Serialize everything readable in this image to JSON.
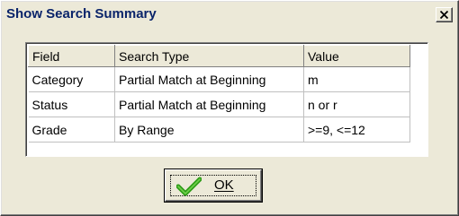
{
  "window": {
    "title": "Show Search Summary",
    "close_symbol": "×"
  },
  "grid": {
    "columns": [
      "Field",
      "Search Type",
      "Value"
    ],
    "rows": [
      [
        "Category",
        "Partial Match at Beginning",
        "m"
      ],
      [
        "Status",
        "Partial Match at Beginning",
        "n or r"
      ],
      [
        "Grade",
        "By Range",
        ">=9, <=12"
      ]
    ]
  },
  "buttons": {
    "ok_label": "OK",
    "ok_icon": "checkmark-icon"
  },
  "colors": {
    "dialog_background": "#ece9d8",
    "title_text": "#0a246a",
    "checkmark_green": "#2d9b16"
  }
}
